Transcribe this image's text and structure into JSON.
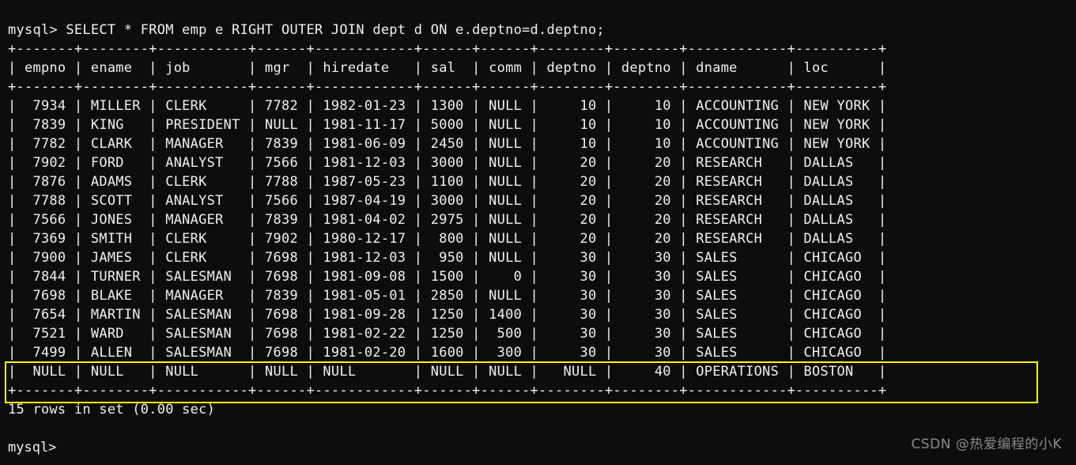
{
  "terminal": {
    "prompt": "mysql>",
    "colors": {
      "background": "#0d0d0d",
      "foreground": "#f0f0f0",
      "highlight": "#ffff00",
      "watermark": "#8a8a8a"
    },
    "command_line": "mysql> SELECT * FROM emp e RIGHT OUTER JOIN dept d ON e.deptno=d.deptno;",
    "query": "SELECT * FROM emp e RIGHT OUTER JOIN dept d ON e.deptno=d.deptno;",
    "result_status": "15 rows in set (0.00 sec)",
    "final_prompt": "mysql>",
    "watermark": "CSDN @热爱编程的小K"
  },
  "table": {
    "separator": "+-------+--------+-----------+------+------------+------+------+--------+--------+------------+----------+",
    "header_line": "| empno | ename  | job       | mgr  | hiredate   | sal  | comm | deptno | deptno | dname      | loc      |",
    "columns": [
      "empno",
      "ename",
      "job",
      "mgr",
      "hiredate",
      "sal",
      "comm",
      "deptno",
      "deptno",
      "dname",
      "loc"
    ],
    "row_count": 15,
    "highlighted_row_index": 14,
    "rows": [
      {
        "empno": "7934",
        "ename": "MILLER",
        "job": "CLERK",
        "mgr": "7782",
        "hiredate": "1982-01-23",
        "sal": "1300",
        "comm": "NULL",
        "deptno_e": "10",
        "deptno_d": "10",
        "dname": "ACCOUNTING",
        "loc": "NEW YORK"
      },
      {
        "empno": "7839",
        "ename": "KING",
        "job": "PRESIDENT",
        "mgr": "NULL",
        "hiredate": "1981-11-17",
        "sal": "5000",
        "comm": "NULL",
        "deptno_e": "10",
        "deptno_d": "10",
        "dname": "ACCOUNTING",
        "loc": "NEW YORK"
      },
      {
        "empno": "7782",
        "ename": "CLARK",
        "job": "MANAGER",
        "mgr": "7839",
        "hiredate": "1981-06-09",
        "sal": "2450",
        "comm": "NULL",
        "deptno_e": "10",
        "deptno_d": "10",
        "dname": "ACCOUNTING",
        "loc": "NEW YORK"
      },
      {
        "empno": "7902",
        "ename": "FORD",
        "job": "ANALYST",
        "mgr": "7566",
        "hiredate": "1981-12-03",
        "sal": "3000",
        "comm": "NULL",
        "deptno_e": "20",
        "deptno_d": "20",
        "dname": "RESEARCH",
        "loc": "DALLAS"
      },
      {
        "empno": "7876",
        "ename": "ADAMS",
        "job": "CLERK",
        "mgr": "7788",
        "hiredate": "1987-05-23",
        "sal": "1100",
        "comm": "NULL",
        "deptno_e": "20",
        "deptno_d": "20",
        "dname": "RESEARCH",
        "loc": "DALLAS"
      },
      {
        "empno": "7788",
        "ename": "SCOTT",
        "job": "ANALYST",
        "mgr": "7566",
        "hiredate": "1987-04-19",
        "sal": "3000",
        "comm": "NULL",
        "deptno_e": "20",
        "deptno_d": "20",
        "dname": "RESEARCH",
        "loc": "DALLAS"
      },
      {
        "empno": "7566",
        "ename": "JONES",
        "job": "MANAGER",
        "mgr": "7839",
        "hiredate": "1981-04-02",
        "sal": "2975",
        "comm": "NULL",
        "deptno_e": "20",
        "deptno_d": "20",
        "dname": "RESEARCH",
        "loc": "DALLAS"
      },
      {
        "empno": "7369",
        "ename": "SMITH",
        "job": "CLERK",
        "mgr": "7902",
        "hiredate": "1980-12-17",
        "sal": "800",
        "comm": "NULL",
        "deptno_e": "20",
        "deptno_d": "20",
        "dname": "RESEARCH",
        "loc": "DALLAS"
      },
      {
        "empno": "7900",
        "ename": "JAMES",
        "job": "CLERK",
        "mgr": "7698",
        "hiredate": "1981-12-03",
        "sal": "950",
        "comm": "NULL",
        "deptno_e": "30",
        "deptno_d": "30",
        "dname": "SALES",
        "loc": "CHICAGO"
      },
      {
        "empno": "7844",
        "ename": "TURNER",
        "job": "SALESMAN",
        "mgr": "7698",
        "hiredate": "1981-09-08",
        "sal": "1500",
        "comm": "0",
        "deptno_e": "30",
        "deptno_d": "30",
        "dname": "SALES",
        "loc": "CHICAGO"
      },
      {
        "empno": "7698",
        "ename": "BLAKE",
        "job": "MANAGER",
        "mgr": "7839",
        "hiredate": "1981-05-01",
        "sal": "2850",
        "comm": "NULL",
        "deptno_e": "30",
        "deptno_d": "30",
        "dname": "SALES",
        "loc": "CHICAGO"
      },
      {
        "empno": "7654",
        "ename": "MARTIN",
        "job": "SALESMAN",
        "mgr": "7698",
        "hiredate": "1981-09-28",
        "sal": "1250",
        "comm": "1400",
        "deptno_e": "30",
        "deptno_d": "30",
        "dname": "SALES",
        "loc": "CHICAGO"
      },
      {
        "empno": "7521",
        "ename": "WARD",
        "job": "SALESMAN",
        "mgr": "7698",
        "hiredate": "1981-02-22",
        "sal": "1250",
        "comm": "500",
        "deptno_e": "30",
        "deptno_d": "30",
        "dname": "SALES",
        "loc": "CHICAGO"
      },
      {
        "empno": "7499",
        "ename": "ALLEN",
        "job": "SALESMAN",
        "mgr": "7698",
        "hiredate": "1981-02-20",
        "sal": "1600",
        "comm": "300",
        "deptno_e": "30",
        "deptno_d": "30",
        "dname": "SALES",
        "loc": "CHICAGO"
      },
      {
        "empno": "NULL",
        "ename": "NULL",
        "job": "NULL",
        "mgr": "NULL",
        "hiredate": "NULL",
        "sal": "NULL",
        "comm": "NULL",
        "deptno_e": "NULL",
        "deptno_d": "40",
        "dname": "OPERATIONS",
        "loc": "BOSTON"
      }
    ]
  }
}
